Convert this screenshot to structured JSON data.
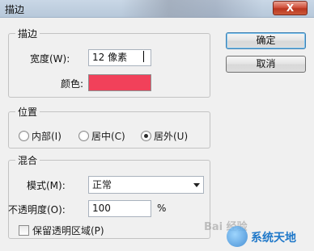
{
  "window": {
    "title": "描边",
    "close_label": "X"
  },
  "stroke": {
    "legend": "描边",
    "width_label": "宽度(W):",
    "width_value": "12 像素",
    "color_label": "颜色:",
    "color_value": "#f1415a"
  },
  "position": {
    "legend": "位置",
    "options": [
      "内部(I)",
      "居中(C)",
      "居外(U)"
    ],
    "selected": "居外(U)"
  },
  "blend": {
    "legend": "混合",
    "mode_label": "模式(M):",
    "mode_value": "正常",
    "opacity_label": "不透明度(O):",
    "opacity_value": "100",
    "opacity_unit": "%",
    "preserve_label": "保留透明区域(P)"
  },
  "buttons": {
    "ok": "确定",
    "cancel": "取消"
  },
  "watermark": {
    "text1": "Bai 经验",
    "text2": "系统天地"
  }
}
